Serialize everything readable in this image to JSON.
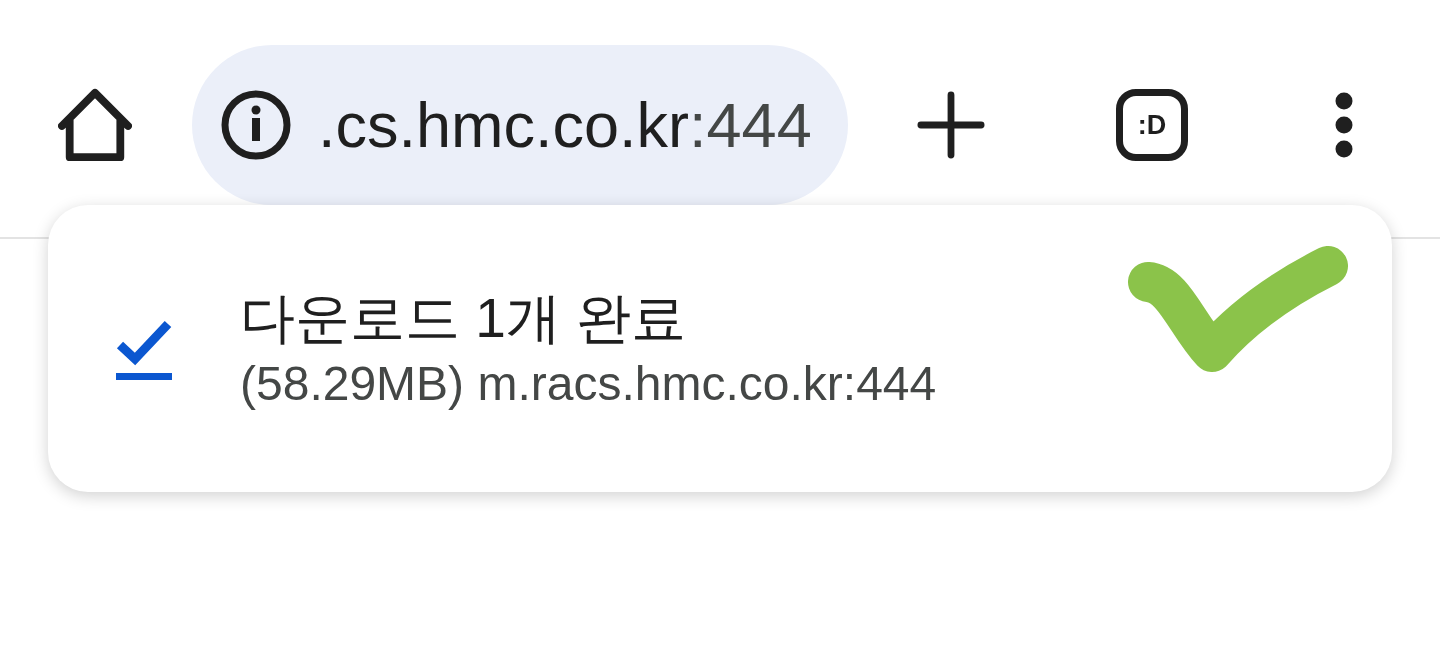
{
  "toolbar": {
    "address_bar": {
      "host": ".cs.hmc.co.kr",
      "port": ":444"
    },
    "tab_switcher": {
      "label": ":D"
    }
  },
  "download_message": {
    "title": "다운로드 1개 완료",
    "details": "(58.29MB) m.racs.hmc.co.kr:444"
  }
}
